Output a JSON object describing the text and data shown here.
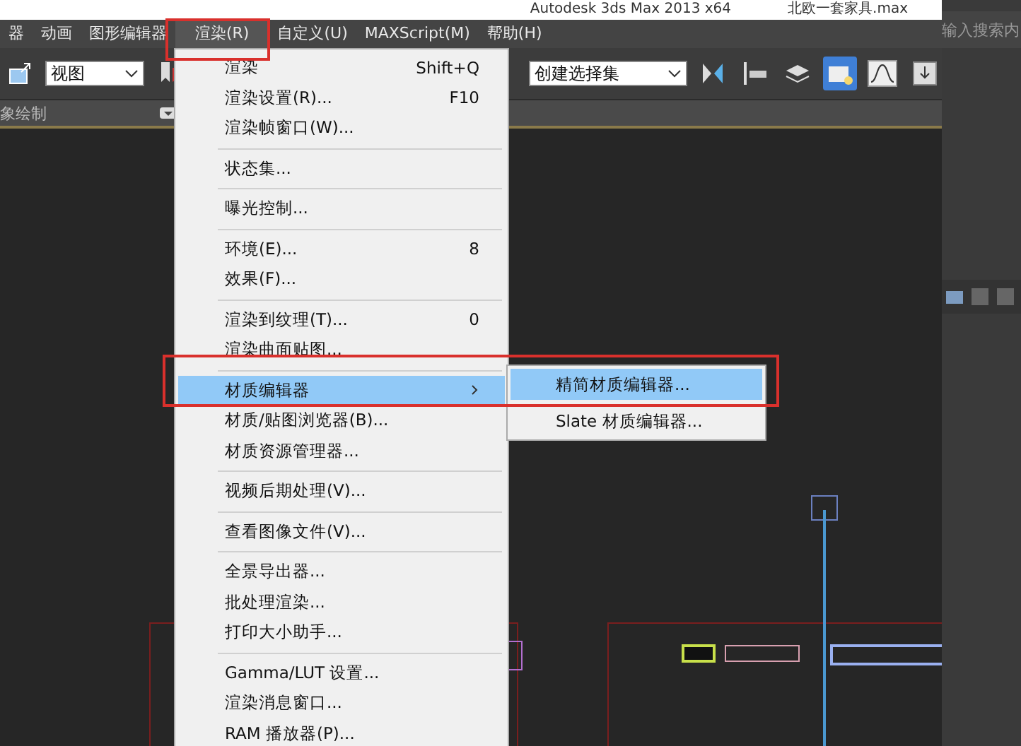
{
  "window": {
    "title": "Autodesk 3ds Max  2013 x64",
    "file": "北欧一套家具.max"
  },
  "menu_bar": [
    {
      "label": "器",
      "selected": false
    },
    {
      "label": "动画",
      "selected": false
    },
    {
      "label": "图形编辑器",
      "selected": false
    },
    {
      "label": "渲染(R)",
      "selected": true
    },
    {
      "label": "自定义(U)",
      "selected": false
    },
    {
      "label": "MAXScript(M)",
      "selected": false
    },
    {
      "label": "帮助(H)",
      "selected": false
    }
  ],
  "toolbar": {
    "view_dropdown": "视图",
    "selection_set_dropdown": "创建选择集"
  },
  "viewport_bar": {
    "label": "象绘制"
  },
  "side_panel": {
    "search_placeholder": "输入搜索内"
  },
  "render_menu": [
    {
      "kind": "item",
      "label": "渲染",
      "shortcut": "Shift+Q"
    },
    {
      "kind": "item",
      "label": "渲染设置(R)...",
      "shortcut": "F10"
    },
    {
      "kind": "item",
      "label": "渲染帧窗口(W)..."
    },
    {
      "kind": "separator"
    },
    {
      "kind": "item",
      "label": "状态集..."
    },
    {
      "kind": "separator"
    },
    {
      "kind": "item",
      "label": "曝光控制..."
    },
    {
      "kind": "separator"
    },
    {
      "kind": "item",
      "label": "环境(E)...",
      "shortcut": "8"
    },
    {
      "kind": "item",
      "label": "效果(F)..."
    },
    {
      "kind": "separator"
    },
    {
      "kind": "item",
      "label": "渲染到纹理(T)...",
      "shortcut": "0"
    },
    {
      "kind": "item",
      "label": "渲染曲面贴图..."
    },
    {
      "kind": "separator"
    },
    {
      "kind": "submenu",
      "label": "材质编辑器",
      "selected": true,
      "children": [
        {
          "label": "精简材质编辑器...",
          "selected": true
        },
        {
          "label": "Slate 材质编辑器...",
          "selected": false
        }
      ]
    },
    {
      "kind": "item",
      "label": "材质/贴图浏览器(B)..."
    },
    {
      "kind": "item",
      "label": "材质资源管理器..."
    },
    {
      "kind": "separator"
    },
    {
      "kind": "item",
      "label": "视频后期处理(V)..."
    },
    {
      "kind": "separator"
    },
    {
      "kind": "item",
      "label": "查看图像文件(V)..."
    },
    {
      "kind": "separator"
    },
    {
      "kind": "item",
      "label": "全景导出器..."
    },
    {
      "kind": "item",
      "label": "批处理渲染..."
    },
    {
      "kind": "item",
      "label": "打印大小助手..."
    },
    {
      "kind": "separator"
    },
    {
      "kind": "item",
      "label": "Gamma/LUT 设置..."
    },
    {
      "kind": "item",
      "label": "渲染消息窗口..."
    },
    {
      "kind": "item",
      "label": "RAM 播放器(P)..."
    }
  ]
}
